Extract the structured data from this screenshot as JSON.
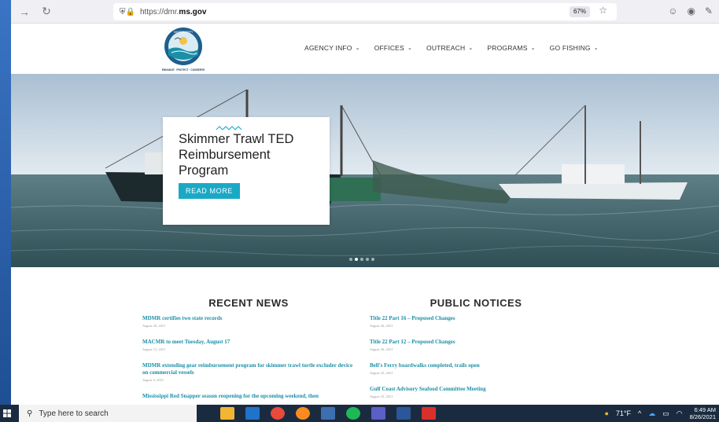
{
  "browser": {
    "url_prefix": "https://dmr.",
    "url_domain": "ms.gov",
    "zoom": "67%"
  },
  "nav": {
    "items": [
      {
        "label": "AGENCY INFO"
      },
      {
        "label": "OFFICES"
      },
      {
        "label": "OUTREACH"
      },
      {
        "label": "PROGRAMS"
      },
      {
        "label": "GO FISHING"
      }
    ]
  },
  "logo": {
    "text_top": "MISSISSIPPI",
    "text_bottom": "ENHANCE · PROTECT · CONSERVE"
  },
  "hero": {
    "title": "Skimmer Trawl TED Reimbursement Program",
    "button": "READ MORE",
    "slides": 5,
    "active_slide": 2
  },
  "recent_news": {
    "heading": "RECENT NEWS",
    "items": [
      {
        "title": "MDMR certifies two state records",
        "date": "August 20, 2021"
      },
      {
        "title": "MACMR to meet Tuesday, August 17",
        "date": "August 13, 2021"
      },
      {
        "title": "MDMR extending gear reimbursement program for skimmer trawl turtle excluder device on commercial vessels",
        "date": "August 5, 2021"
      },
      {
        "title": "Mississippi Red Snapper season reopening for the upcoming weekend, then",
        "date": ""
      }
    ]
  },
  "public_notices": {
    "heading": "PUBLIC NOTICES",
    "items": [
      {
        "title": "Title 22 Part 16 – Proposed Changes",
        "date": "August 26, 2021"
      },
      {
        "title": "Title 22 Part 12 – Proposed Changes",
        "date": "August 26, 2021"
      },
      {
        "title": "Bell's Ferry boardwalks completed, trails open",
        "date": "August 25, 2021"
      },
      {
        "title": "Gulf Coast Advisory Seafood Committee Meeting",
        "date": "August 25, 2021"
      }
    ]
  },
  "taskbar": {
    "search_placeholder": "Type here to search",
    "weather": "71°F",
    "time": "6:49 AM",
    "date": "8/26/2021"
  },
  "colors": {
    "accent": "#19a9c5",
    "link": "#1a8fa7",
    "taskbar": "#1b2b3f"
  }
}
